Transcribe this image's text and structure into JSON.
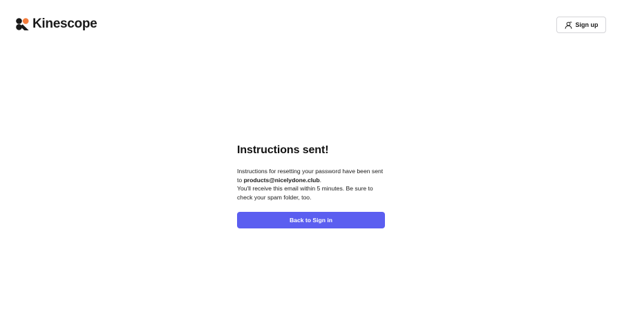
{
  "header": {
    "brand_name": "Kinescope",
    "brand_colors": {
      "accent": "#f47c3c",
      "dark": "#1a1a1a"
    },
    "signup": {
      "label": "Sign up",
      "icon": "user-icon"
    }
  },
  "main": {
    "title": "Instructions sent!",
    "message": {
      "line_1": "Instructions for resetting your password have been sent to ",
      "email": "products@nicelydone.club",
      "email_suffix": ".",
      "line_2": "You'll receive this email within 5 minutes. Be sure to check your spam folder, too."
    },
    "back_button": {
      "label": "Back to Sign in",
      "color": "#5b5ef0"
    }
  }
}
